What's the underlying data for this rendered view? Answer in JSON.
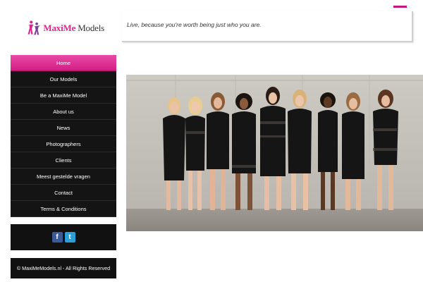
{
  "header": {
    "logo_alt": "MaxiMe Models",
    "logo_maxi": "Maxi",
    "logo_me": "Me",
    "logo_models": " Models",
    "tagline": "Live, because you're worth being just who you are."
  },
  "nav": {
    "items": [
      {
        "label": "Home",
        "active": true
      },
      {
        "label": "Our Models",
        "active": false
      },
      {
        "label": "Be a MaxiMe Model",
        "active": false
      },
      {
        "label": "About us",
        "active": false
      },
      {
        "label": "News",
        "active": false
      },
      {
        "label": "Photographers",
        "active": false
      },
      {
        "label": "Clients",
        "active": false
      },
      {
        "label": "Meest gestelde vragen",
        "active": false
      },
      {
        "label": "Contact",
        "active": false
      },
      {
        "label": "Terms & Conditions",
        "active": false
      }
    ]
  },
  "social": {
    "facebook_glyph": "f",
    "twitter_glyph": "t",
    "facebook_icon": "facebook-icon",
    "twitter_icon": "twitter-icon"
  },
  "footer": {
    "copyright": "© MaxiMeModels.nl - All Rights Reserved"
  },
  "colors": {
    "brand_pink": "#d21e84",
    "nav_bg": "#141414",
    "facebook_blue": "#3b5a9a",
    "twitter_blue": "#2a9fd9"
  }
}
